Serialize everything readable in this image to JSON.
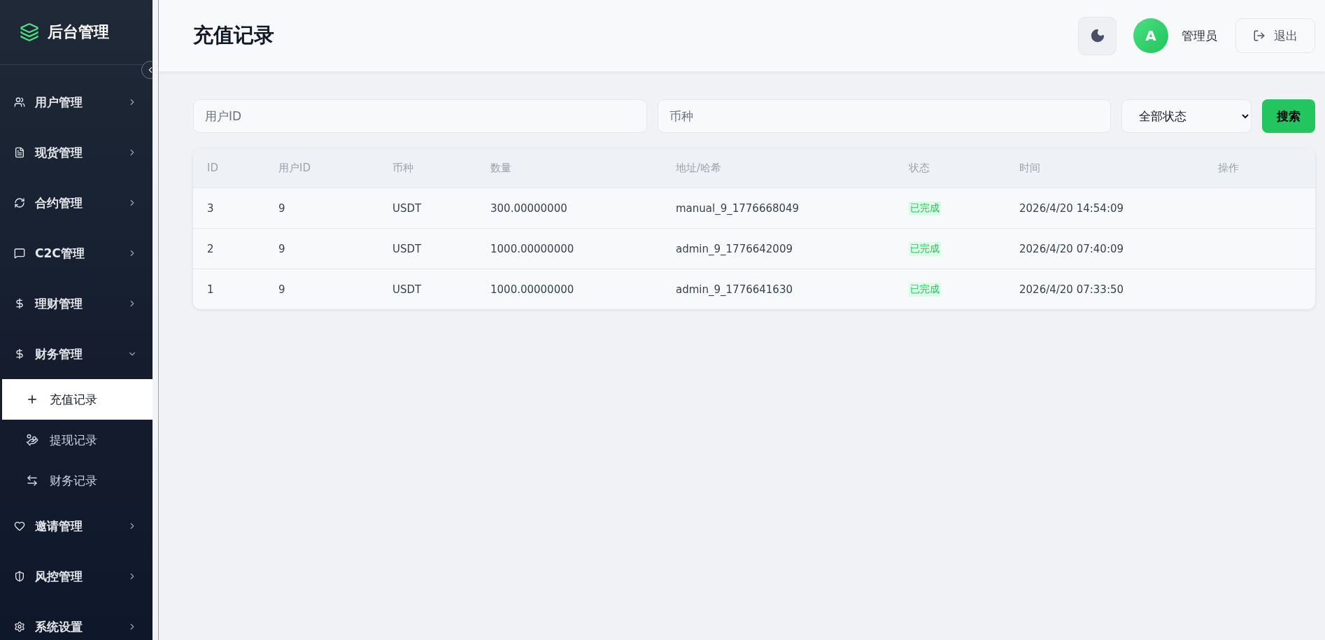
{
  "sidebar": {
    "logo": "后台管理",
    "items": [
      {
        "label": "用户管理",
        "expanded": false
      },
      {
        "label": "现货管理",
        "expanded": false
      },
      {
        "label": "合约管理",
        "expanded": false
      },
      {
        "label": "C2C管理",
        "expanded": false
      },
      {
        "label": "理财管理",
        "expanded": false
      },
      {
        "label": "财务管理",
        "expanded": true,
        "children": [
          {
            "label": "充值记录",
            "selected": true
          },
          {
            "label": "提现记录",
            "selected": false
          },
          {
            "label": "财务记录",
            "selected": false
          }
        ]
      },
      {
        "label": "邀请管理",
        "expanded": false
      },
      {
        "label": "风控管理",
        "expanded": false
      },
      {
        "label": "系统设置",
        "expanded": false
      }
    ]
  },
  "header": {
    "title": "充值记录",
    "avatar": "A",
    "user": "管理员",
    "logout": "退出"
  },
  "filters": {
    "user_id": {
      "placeholder": "用户ID"
    },
    "currency": {
      "placeholder": "币种"
    },
    "status": {
      "value": "全部状态"
    },
    "search_button": "搜索"
  },
  "table": {
    "columns": [
      "ID",
      "用户ID",
      "币种",
      "数量",
      "地址/哈希",
      "状态",
      "时间",
      "操作"
    ],
    "rows": [
      {
        "id": "3",
        "user_id": "9",
        "currency": "USDT",
        "amount": "300.00000000",
        "address": "manual_9_1776668049",
        "status": "已完成",
        "time": "2026/4/20 14:54:09"
      },
      {
        "id": "2",
        "user_id": "9",
        "currency": "USDT",
        "amount": "1000.00000000",
        "address": "admin_9_1776642009",
        "status": "已完成",
        "time": "2026/4/20 07:40:09"
      },
      {
        "id": "1",
        "user_id": "9",
        "currency": "USDT",
        "amount": "1000.00000000",
        "address": "admin_9_1776641630",
        "status": "已完成",
        "time": "2026/4/20 07:33:50"
      }
    ]
  }
}
